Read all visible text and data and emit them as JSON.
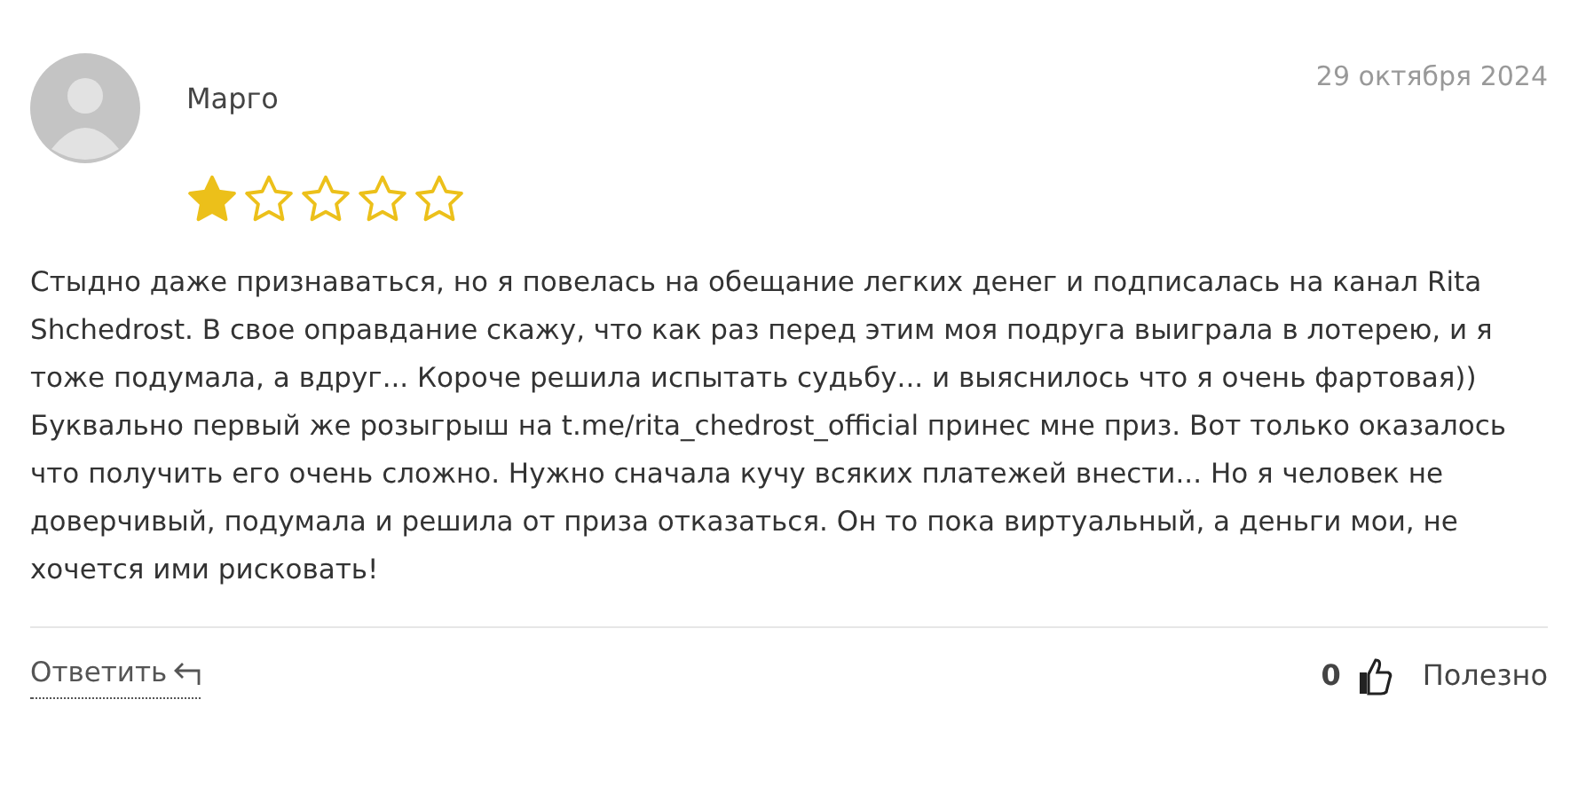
{
  "review": {
    "author": "Марго",
    "date": "29 октября 2024",
    "stars": 1,
    "text": "Стыдно даже признаваться, но я повелась на обещание легких денег и подписалась на канал Rita Shchedrost. В свое оправдание скажу, что как раз перед этим моя подруга выиграла в лотерею, и я тоже подумала, а вдруг... Короче решила испытать судьбу... и выяснилось что я очень фартовая)) Буквально первый же розыгрыш на t.me/rita_chedrost_official принес мне приз. Вот только оказалось что получить его очень сложно. Нужно сначала кучу всяких платежей внести... Но я человек не доверчивый, подумала и решила от приза отказаться. Он то пока виртуальный, а деньги мои, не хочется ими рисковать!"
  },
  "footer": {
    "reply": "Ответить",
    "likes": "0",
    "helpful": "Полезно"
  }
}
